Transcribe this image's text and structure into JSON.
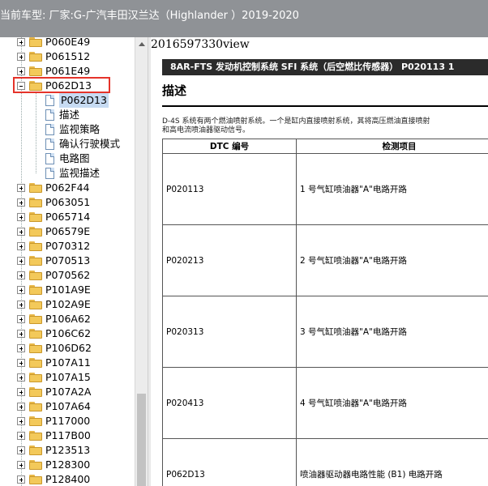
{
  "header": {
    "vehicle": "当前车型:  厂家:G-广汽丰田汉兰达（Highlander ）2019-2020"
  },
  "tree": {
    "folders_above": [
      "P060E49",
      "P061512",
      "P061E49"
    ],
    "open_folder": "P062D13",
    "children": [
      "P062D13",
      "描述",
      "监视策略",
      "确认行驶模式",
      "电路图",
      "监视描述"
    ],
    "selected_child": 0,
    "folders_below": [
      "P062F44",
      "P063051",
      "P065714",
      "P06579E",
      "P070312",
      "P070513",
      "P070562",
      "P101A9E",
      "P102A9E",
      "P106A62",
      "P106C62",
      "P106D62",
      "P107A11",
      "P107A15",
      "P107A2A",
      "P107A64",
      "P117000",
      "P117B00",
      "P123513",
      "P128300",
      "P128400"
    ]
  },
  "content": {
    "doc_id": "2016597330view",
    "banner": "8AR-FTS 发动机控制系统  SFI 系统（后空燃比传感器）  P020113  1",
    "section_title": "描述",
    "description_line1": "D-4S 系统有两个燃油喷射系统。一个是缸内直接喷射系统，其将高压燃油直接喷射",
    "description_line2": "和高电流喷油器驱动信号。",
    "table": {
      "headers": [
        "DTC 编号",
        "检测项目"
      ],
      "rows": [
        {
          "code": "P020113",
          "item": "1 号气缸喷油器\"A\"电路开路"
        },
        {
          "code": "P020213",
          "item": "2 号气缸喷油器\"A\"电路开路"
        },
        {
          "code": "P020313",
          "item": "3 号气缸喷油器\"A\"电路开路"
        },
        {
          "code": "P020413",
          "item": "4 号气缸喷油器\"A\"电路开路"
        },
        {
          "code": "P062D13",
          "item": "喷油器驱动器电路性能 (B1) 电路开路"
        }
      ]
    }
  }
}
